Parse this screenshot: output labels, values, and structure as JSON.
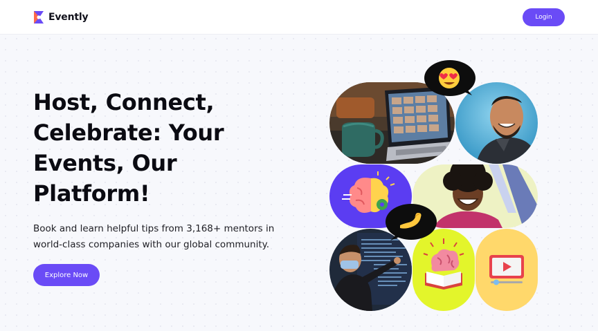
{
  "header": {
    "brand": "Evently",
    "login_label": "Login",
    "logo_icon": "evently-logo-icon"
  },
  "hero": {
    "title": "Host, Connect, Celebrate: Your Events, Our Platform!",
    "subtitle": "Book and learn helpful tips from 3,168+ mentors in world-class companies with our global community.",
    "cta_label": "Explore Now"
  },
  "collage": {
    "emoji_top": "heart-eyes-emoji-icon",
    "emoji_mid": "flexed-arm-emoji-icon"
  },
  "colors": {
    "accent": "#6a4bf6",
    "background": "#f7f8fc",
    "tile_purple": "#5b3df2",
    "tile_lime": "#e3f52b",
    "tile_yellow": "#ffd86b",
    "tile_sky": "#36a7cf"
  }
}
